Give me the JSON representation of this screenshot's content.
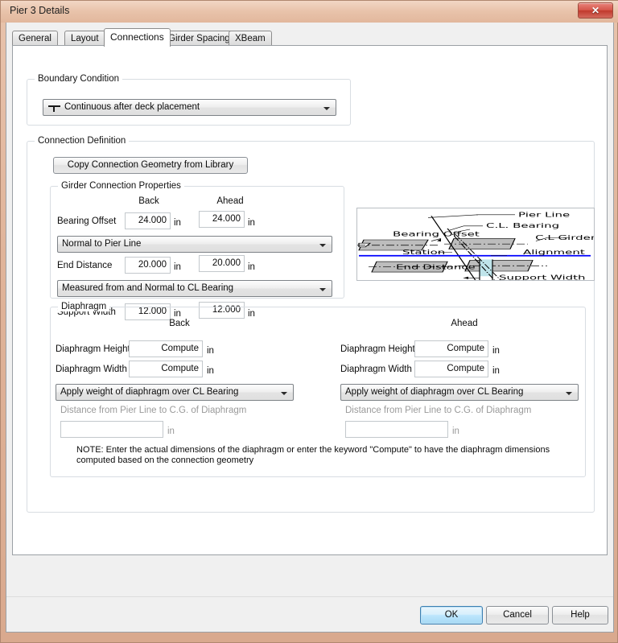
{
  "window": {
    "title": "Pier 3 Details",
    "close_label": "✕",
    "close_icon": "close-icon"
  },
  "tabs": [
    {
      "label": "General",
      "active": false
    },
    {
      "label": "Layout",
      "active": false
    },
    {
      "label": "Connections",
      "active": true
    },
    {
      "label": "Girder Spacing",
      "active": false
    },
    {
      "label": "XBeam",
      "active": false
    }
  ],
  "boundary_condition": {
    "legend": "Boundary Condition",
    "selected": "Continuous after deck placement",
    "icon": "pier-support-icon"
  },
  "connection_definition": {
    "legend": "Connection Definition",
    "copy_button": "Copy Connection Geometry from Library"
  },
  "girder_connection": {
    "legend": "Girder Connection Properties",
    "col_back": "Back",
    "col_ahead": "Ahead",
    "unit": "in",
    "rows": [
      {
        "label": "Bearing Offset",
        "back": "24.000",
        "ahead": "24.000"
      },
      {
        "label": "End Distance",
        "back": "20.000",
        "ahead": "20.000"
      },
      {
        "label": "Support Width",
        "back": "12.000",
        "ahead": "12.000"
      }
    ],
    "bearing_offset_measure": "Normal to Pier Line",
    "end_distance_measure": "Measured from and Normal to CL Bearing"
  },
  "diaphragm": {
    "legend": "Diaphragm",
    "col_back": "Back",
    "col_ahead": "Ahead",
    "unit": "in",
    "height_label": "Diaphragm Height",
    "width_label": "Diaphragm Width",
    "back": {
      "height": "Compute",
      "width": "Compute",
      "weight_option": "Apply weight of diaphragm over CL Bearing",
      "distance_label": "Distance from Pier Line to C.G. of Diaphragm",
      "distance_value": ""
    },
    "ahead": {
      "height": "Compute",
      "width": "Compute",
      "weight_option": "Apply weight of diaphragm over CL Bearing",
      "distance_label": "Distance from Pier Line to C.G. of Diaphragm",
      "distance_value": ""
    },
    "note": "NOTE: Enter the actual dimensions of the diaphragm or enter the keyword \"Compute\" to have the diaphragm dimensions computed based on the connection geometry"
  },
  "diagram": {
    "name": "connection-geometry-diagram",
    "labels": {
      "pier_line": "Pier Line",
      "cl_bearing": "C.L. Bearing",
      "cl_girder": "C.L Girder",
      "bearing_offset": "Bearing Offset",
      "station": "Station",
      "alignment": "Alignment",
      "end_distance": "End Distance",
      "support_width": "Support Width"
    },
    "colors": {
      "girder_fill": "#bdbdbd",
      "alignment_line": "#0000ff",
      "support_hatch": "#bfe4ea",
      "line": "#000000"
    }
  },
  "footer": {
    "ok": "OK",
    "cancel": "Cancel",
    "help": "Help"
  }
}
